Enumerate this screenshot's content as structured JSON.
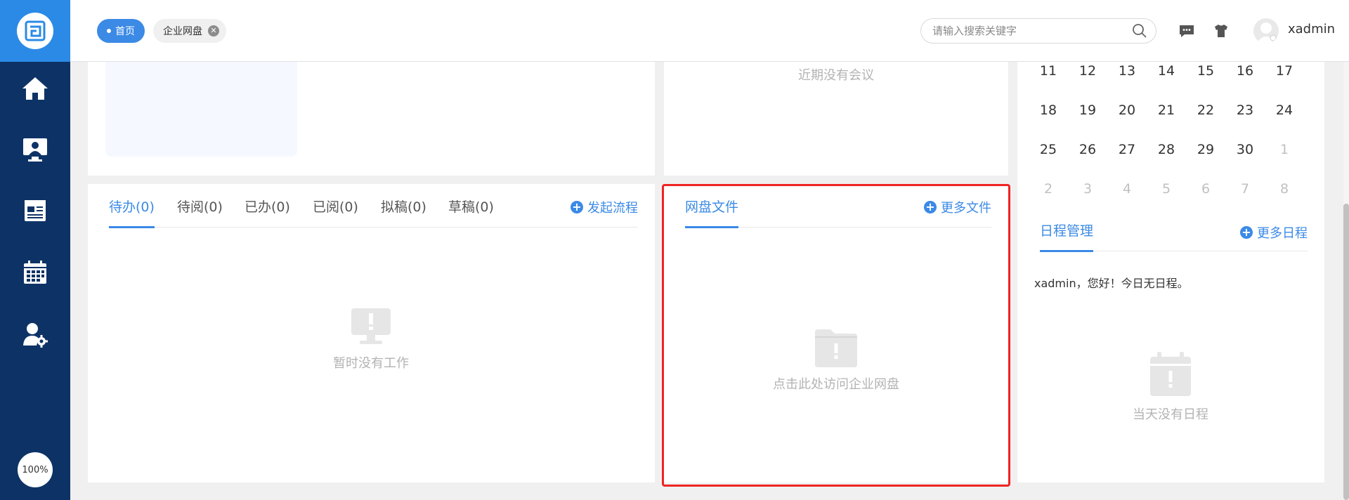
{
  "header": {
    "tabs": [
      {
        "label": "首页",
        "active": true
      },
      {
        "label": "企业网盘",
        "active": false
      }
    ],
    "tab_close_glyph": "✕",
    "search": {
      "placeholder": "请输入搜索关键字",
      "value": ""
    },
    "username": "xadmin"
  },
  "sidebar": {
    "items": [
      {
        "icon": "home-icon"
      },
      {
        "icon": "meeting-icon"
      },
      {
        "icon": "news-icon"
      },
      {
        "icon": "calendar-icon"
      },
      {
        "icon": "user-settings-icon"
      }
    ],
    "zoom": "100%"
  },
  "meeting": {
    "empty_text": "近期没有会议"
  },
  "workflow": {
    "tabs": [
      {
        "label": "待办(0)",
        "active": true
      },
      {
        "label": "待阅(0)",
        "active": false
      },
      {
        "label": "已办(0)",
        "active": false
      },
      {
        "label": "已阅(0)",
        "active": false
      },
      {
        "label": "拟稿(0)",
        "active": false
      },
      {
        "label": "草稿(0)",
        "active": false
      }
    ],
    "action": "发起流程",
    "empty_text": "暂时没有工作"
  },
  "netdisk": {
    "title": "网盘文件",
    "more": "更多文件",
    "empty_text": "点击此处访问企业网盘"
  },
  "calendar": {
    "rows": [
      [
        "11",
        "12",
        "13",
        "14",
        "15",
        "16",
        "17"
      ],
      [
        "18",
        "19",
        "20",
        "21",
        "22",
        "23",
        "24"
      ],
      [
        "25",
        "26",
        "27",
        "28",
        "29",
        "30",
        "1"
      ],
      [
        "2",
        "3",
        "4",
        "5",
        "6",
        "7",
        "8"
      ]
    ],
    "muted": [
      [
        false,
        false,
        false,
        false,
        false,
        false,
        false
      ],
      [
        false,
        false,
        false,
        false,
        false,
        false,
        false
      ],
      [
        false,
        false,
        false,
        false,
        false,
        false,
        true
      ],
      [
        true,
        true,
        true,
        true,
        true,
        true,
        true
      ]
    ]
  },
  "schedule": {
    "title": "日程管理",
    "more": "更多日程",
    "greeting": "xadmin，您好！今日无日程。",
    "empty_text": "当天没有日程"
  },
  "colors": {
    "accent": "#3b8ae6",
    "sidebar": "#0d3366",
    "highlight": "#f02323"
  }
}
